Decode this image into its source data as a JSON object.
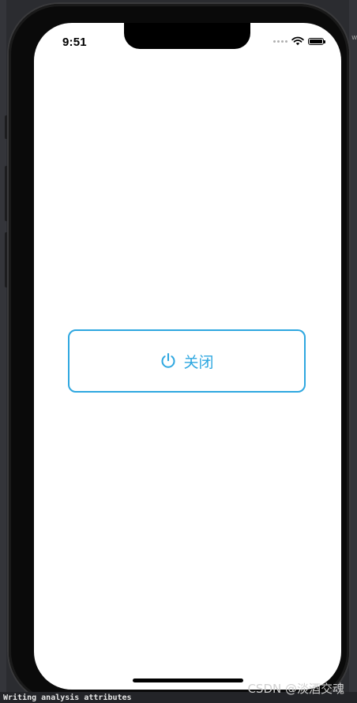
{
  "status_bar": {
    "time": "9:51"
  },
  "main": {
    "close_button": {
      "label": "关闭",
      "icon": "power-icon",
      "color": "#2ea7e0"
    }
  },
  "watermark": "CSDN @淡酒交魂",
  "console": {
    "text": "Writing analysis attributes"
  },
  "host_window": {
    "right_edge_text": "w"
  }
}
